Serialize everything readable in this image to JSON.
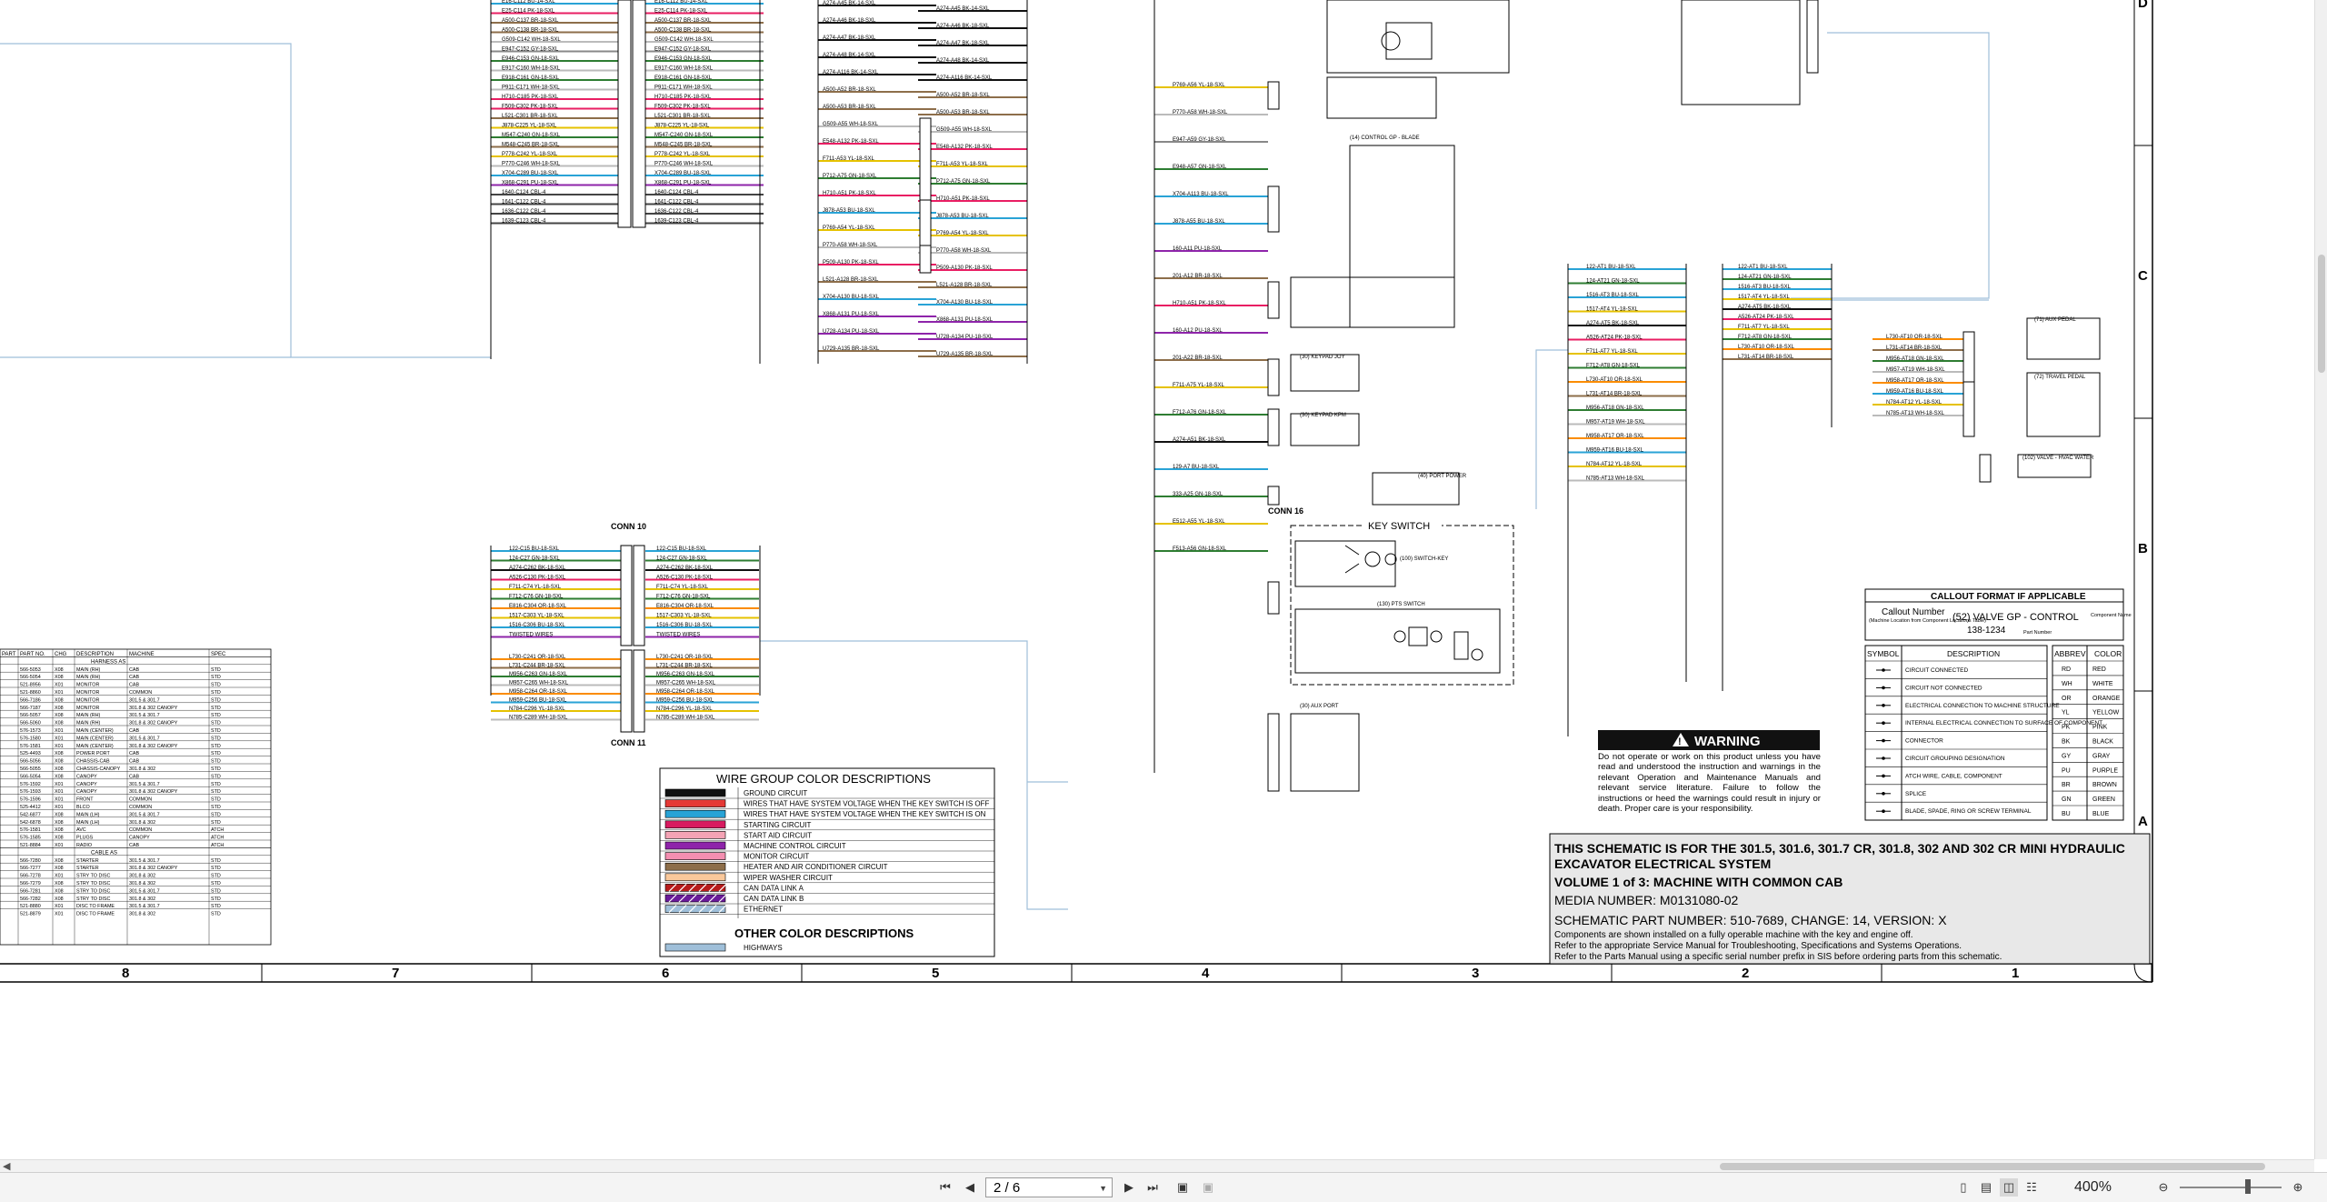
{
  "schematic": {
    "connectors": {
      "conn10": "CONN 10",
      "conn11": "CONN 11",
      "conn16": "CONN 16",
      "key_switch": "KEY SWITCH"
    },
    "zones_top": [
      "D",
      "C",
      "B",
      "A"
    ],
    "zones_bottom": [
      "8",
      "7",
      "6",
      "5",
      "4",
      "3",
      "2",
      "1"
    ],
    "wire_labels_left": [
      "E16-C112 BU-14-SXL",
      "E25-C114 PK-18-SXL",
      "A500-C137 BR-18-SXL",
      "A500-C138 BR-18-SXL",
      "G509-C142 WH-18-SXL",
      "E947-C152 GY-18-SXL",
      "E946-C153 GN-18-SXL",
      "E917-C160 WH-18-SXL",
      "E918-C161 GN-18-SXL",
      "P911-C171 WH-18-SXL",
      "H710-C185 PK-18-SXL",
      "F509-C302 PK-18-SXL",
      "L521-C301 BR-18-SXL",
      "J878-C225 YL-18-SXL",
      "M547-C240 GN-18-SXL",
      "M548-C245 BR-18-SXL",
      "P778-C242 YL-18-SXL",
      "P770-C246 WH-18-SXL",
      "X704-C289 BU-18-SXL",
      "X868-C291 PU-18-SXL",
      "1640-C124 CBL-4",
      "1641-C122 CBL-4",
      "1636-C122 CBL-4",
      "1639-C123 CBL-4"
    ],
    "wire_labels_mid": [
      "A274-A45 BK-14-SXL",
      "A274-A46 BK-18-SXL",
      "A274-A47 BK-18-SXL",
      "A274-A48 BK-14-SXL",
      "A274-A116 BK-14-SXL",
      "A500-A52 BR-18-SXL",
      "A500-A53 BR-18-SXL",
      "G509-A55 WH-18-SXL",
      "E548-A132 PK-18-SXL",
      "F711-A53 YL-18-SXL",
      "P712-A75 GN-18-SXL",
      "H710-A51 PK-18-SXL",
      "J878-A53 BU-18-SXL",
      "P769-A54 YL-18-SXL",
      "P770-A58 WH-18-SXL",
      "P509-A130 PK-18-SXL",
      "L521-A128 BR-18-SXL",
      "X704-A130 BU-18-SXL",
      "X868-A131 PU-18-SXL",
      "U728-A134 PU-18-SXL",
      "U729-A135 BR-18-SXL"
    ],
    "wire_labels_conn10": [
      "122-C15 BU-18-SXL",
      "124-C27 GN-18-SXL",
      "A274-C262 BK-18-SXL",
      "A526-C130 PK-18-SXL",
      "F711-C74 YL-18-SXL",
      "F712-C76 GN-18-SXL",
      "E816-C304 OR-18-SXL",
      "1517-C303 YL-18-SXL",
      "1516-C306 BU-18-SXL",
      "TWISTED WIRES"
    ],
    "wire_labels_conn11": [
      "L730-C241 OR-18-SXL",
      "L731-C244 BR-18-SXL",
      "M956-C263 GN-18-SXL",
      "M957-C265 WH-18-SXL",
      "M958-C264 OR-18-SXL",
      "M959-C256 BU-18-SXL",
      "N784-C296 YL-18-SXL",
      "N785-C289 WH-18-SXL"
    ],
    "wire_labels_right": [
      "P769-A56 YL-18-SXL",
      "P770-A58 WH-18-SXL",
      "E947-A59 GY-18-SXL",
      "E948-A57 GN-18-SXL",
      "X704-A113 BU-18-SXL",
      "J878-A55 BU-18-SXL",
      "160-A11 PU-18-SXL",
      "201-A12 BR-18-SXL",
      "H710-A51 PK-18-SXL",
      "160-A12 PU-18-SXL",
      "201-A22 BR-18-SXL",
      "F711-A75 YL-18-SXL",
      "F712-A76 GN-18-SXL",
      "A274-A51 BK-18-SXL",
      "129-A7 BU-18-SXL",
      "333-A25 GN-18-SXL",
      "E512-A55 YL-18-SXL",
      "F513-A56 GN-18-SXL"
    ],
    "wire_labels_far_right": [
      "122-AT1 BU-18-SXL",
      "124-AT21 GN-18-SXL",
      "1516-AT3 BU-18-SXL",
      "1517-AT4 YL-18-SXL",
      "A274-AT5 BK-18-SXL",
      "A526-AT24 PK-18-SXL",
      "F711-AT7 YL-18-SXL",
      "F712-AT8 GN-18-SXL",
      "L730-AT10 OR-18-SXL",
      "L731-AT14 BR-18-SXL",
      "M956-AT18 GN-18-SXL",
      "M957-AT19 WH-18-SXL",
      "M958-AT17 OR-18-SXL",
      "M959-AT16 BU-18-SXL",
      "N784-AT12 YL-18-SXL",
      "N785-AT13 WH-18-SXL"
    ],
    "component_labels": [
      "(14) CONTROL GP - BLADE",
      "(71) AUX PEDAL",
      "(72) TRAVEL PEDAL",
      "(102) VALVE - HVAC WATER",
      "(40) PORT POWER",
      "(30) KEYPAD JOY",
      "(30) KEYPAD KPM",
      "(30) AUX PORT",
      "(100) SWITCH-KEY",
      "(130) PTS SWITCH"
    ]
  },
  "parts_table": {
    "headers": [
      "PART",
      "PART NO.",
      "CHG",
      "DESCRIPTION",
      "MACHINE",
      "SPEC"
    ],
    "section1": "HARNESS AS",
    "rows": [
      [
        "",
        "566-5053",
        "X08",
        "MAIN (RH)",
        "CAB",
        "STD"
      ],
      [
        "",
        "566-5054",
        "X08",
        "MAIN (RH)",
        "CAB",
        "STD"
      ],
      [
        "",
        "521-8956",
        "X01",
        "MONITOR",
        "CAB",
        "STD"
      ],
      [
        "",
        "521-8860",
        "X01",
        "MONITOR",
        "COMMON",
        "STD"
      ],
      [
        "",
        "566-7186",
        "X08",
        "MONITOR",
        "301.5 & 301.7",
        "STD"
      ],
      [
        "",
        "566-7187",
        "X08",
        "MONITOR",
        "301.8 & 302 CANOPY",
        "STD"
      ],
      [
        "",
        "566-5057",
        "X08",
        "MAIN (RH)",
        "301.5 & 301.7",
        "STD"
      ],
      [
        "",
        "566-5060",
        "X08",
        "MAIN (RH)",
        "301.8 & 302 CANOPY",
        "STD"
      ],
      [
        "",
        "576-1573",
        "X01",
        "MAIN (CENTER)",
        "CAB",
        "STD"
      ],
      [
        "",
        "576-1580",
        "X01",
        "MAIN (CENTER)",
        "301.5 & 301.7",
        "STD"
      ],
      [
        "",
        "576-1581",
        "X01",
        "MAIN (CENTER)",
        "301.8 & 302 CANOPY",
        "STD"
      ],
      [
        "",
        "525-4493",
        "X08",
        "POWER PORT",
        "CAB",
        "STD"
      ],
      [
        "",
        "566-5056",
        "X08",
        "CHASSIS-CAB",
        "CAB",
        "STD"
      ],
      [
        "",
        "566-5055",
        "X08",
        "CHASSIS-CANOPY",
        "301.8 & 302",
        "STD"
      ],
      [
        "",
        "566-5054",
        "X08",
        "CANOPY",
        "CAB",
        "STD"
      ],
      [
        "",
        "576-1592",
        "X01",
        "CANOPY",
        "301.5 & 301.7",
        "STD"
      ],
      [
        "",
        "576-1593",
        "X01",
        "CANOPY",
        "301.8 & 302 CANOPY",
        "STD"
      ],
      [
        "",
        "576-1596",
        "X01",
        "FRONT",
        "COMMON",
        "STD"
      ],
      [
        "",
        "525-4412",
        "X01",
        "BLCO",
        "COMMON",
        "STD"
      ],
      [
        "",
        "542-6877",
        "X08",
        "MAIN (LH)",
        "301.5 & 301.7",
        "STD"
      ],
      [
        "",
        "542-6878",
        "X08",
        "MAIN (LH)",
        "301.8 & 302",
        "STD"
      ],
      [
        "",
        "576-1581",
        "X08",
        "AVC",
        "COMMON",
        "ATCH"
      ],
      [
        "",
        "576-1585",
        "X08",
        "PLUGS",
        "CANOPY",
        "ATCH"
      ],
      [
        "",
        "521-8884",
        "X01",
        "RADIO",
        "CAB",
        "ATCH"
      ]
    ],
    "section2": "CABLE AS",
    "rows2": [
      [
        "",
        "566-7280",
        "X08",
        "STARTER",
        "301.5 & 301.7",
        "STD"
      ],
      [
        "",
        "566-7277",
        "X08",
        "STARTER",
        "301.8 & 302 CANOPY",
        "STD"
      ],
      [
        "",
        "566-7278",
        "X01",
        "STRY TO DISC",
        "301.8 & 302",
        "STD"
      ],
      [
        "",
        "566-7279",
        "X08",
        "STRY TO DISC",
        "301.8 & 302",
        "STD"
      ],
      [
        "",
        "566-7281",
        "X08",
        "STRY TO DISC",
        "301.5 & 301.7",
        "STD"
      ],
      [
        "",
        "566-7282",
        "X08",
        "STRY TO DISC",
        "301.8 & 302",
        "STD"
      ],
      [
        "",
        "521-8880",
        "X01",
        "DISC TO FRAME",
        "301.5 & 301.7",
        "STD"
      ],
      [
        "",
        "521-8879",
        "X01",
        "DISC TO FRAME",
        "301.8 & 302",
        "STD"
      ]
    ]
  },
  "wire_group": {
    "title": "WIRE GROUP COLOR DESCRIPTIONS",
    "items": [
      {
        "label": "GROUND CIRCUIT",
        "color": "#111111"
      },
      {
        "label": "WIRES THAT HAVE SYSTEM VOLTAGE WHEN THE KEY SWITCH IS OFF",
        "color": "#e53935"
      },
      {
        "label": "WIRES THAT HAVE SYSTEM VOLTAGE WHEN THE KEY SWITCH IS ON",
        "color": "#29a3d6"
      },
      {
        "label": "STARTING CIRCUIT",
        "color": "#d81b60"
      },
      {
        "label": "START AID CIRCUIT",
        "color": "#f4a3b5"
      },
      {
        "label": "MACHINE CONTROL CIRCUIT",
        "color": "#8e24aa"
      },
      {
        "label": "MONITOR CIRCUIT",
        "color": "#f48fb1"
      },
      {
        "label": "HEATER AND AIR CONDITIONER CIRCUIT",
        "color": "#8d6e4a"
      },
      {
        "label": "WIPER WASHER CIRCUIT",
        "color": "#f9c89b"
      },
      {
        "label": "CAN DATA LINK A",
        "color": "#b71c1c"
      },
      {
        "label": "CAN DATA LINK B",
        "color": "#6a1b9a"
      },
      {
        "label": "ETHERNET",
        "color": "#9fbfd9"
      }
    ],
    "other_title": "OTHER COLOR DESCRIPTIONS",
    "other_items": [
      {
        "label": "HIGHWAYS",
        "color": "#9fbfd9"
      }
    ]
  },
  "callout": {
    "title": "CALLOUT FORMAT IF APPLICABLE",
    "callout_number": "Callout Number",
    "callout_sub": "(Machine Location from Component Locations Table)",
    "example_main": "(52) VALVE GP - CONTROL",
    "example_part": "138-1234",
    "component_name": "Component Name",
    "part_number": "Part Number"
  },
  "symbols": {
    "headers": [
      "SYMBOL",
      "DESCRIPTION"
    ],
    "rows": [
      "CIRCUIT CONNECTED",
      "CIRCUIT NOT CONNECTED",
      "ELECTRICAL CONNECTION TO MACHINE STRUCTURE",
      "INTERNAL ELECTRICAL CONNECTION TO SURFACE OF COMPONENT",
      "CONNECTOR",
      "CIRCUIT GROUPING DESIGNATION",
      "ATCH WIRE, CABLE, COMPONENT",
      "SPLICE",
      "BLADE, SPADE, RING OR SCREW TERMINAL"
    ]
  },
  "abbrev": {
    "headers": [
      "ABBREV",
      "COLOR"
    ],
    "rows": [
      [
        "RD",
        "RED"
      ],
      [
        "WH",
        "WHITE"
      ],
      [
        "OR",
        "ORANGE"
      ],
      [
        "YL",
        "YELLOW"
      ],
      [
        "PK",
        "PINK"
      ],
      [
        "BK",
        "BLACK"
      ],
      [
        "GY",
        "GRAY"
      ],
      [
        "PU",
        "PURPLE"
      ],
      [
        "BR",
        "BROWN"
      ],
      [
        "GN",
        "GREEN"
      ],
      [
        "BU",
        "BLUE"
      ]
    ]
  },
  "warning": {
    "title": "WARNING",
    "text": "Do not operate or work on this product unless you have read and understood the instruction and warnings in the relevant Operation and Maintenance Manuals and relevant service literature. Failure to follow the instructions or heed the warnings could result in injury or death. Proper care is your responsibility."
  },
  "title_block": {
    "title_line1": "THIS SCHEMATIC IS FOR THE 301.5, 301.6, 301.7 CR, 301.8, 302 AND 302 CR MINI HYDRAULIC",
    "title_line2": "EXCAVATOR ELECTRICAL SYSTEM",
    "volume": "VOLUME 1 of 3: MACHINE WITH COMMON CAB",
    "media": "MEDIA NUMBER: M0131080-02",
    "part_number": "SCHEMATIC PART NUMBER: 510-7689, CHANGE: 14, VERSION: X",
    "note1": "Components are shown installed on a fully operable machine with the key and engine off.",
    "note2": "Refer to the appropriate Service Manual for Troubleshooting, Specifications and Systems Operations.",
    "note3": "Refer to the Parts Manual using a specific serial number prefix in SIS before ordering parts from this schematic."
  },
  "toolbar": {
    "page_value": "2 / 6",
    "zoom": "400%",
    "icons": [
      "first-page-icon",
      "prev-page-icon",
      "next-page-icon",
      "last-page-icon",
      "fit-width-icon",
      "fit-page-icon",
      "single-page-icon",
      "continuous-icon",
      "two-page-icon",
      "thumbnails-icon",
      "zoom-out-icon",
      "zoom-in-icon"
    ]
  },
  "colors": {
    "highway": "#9fbfd9",
    "grid": "#000000",
    "panel": "#e8e8e8"
  }
}
